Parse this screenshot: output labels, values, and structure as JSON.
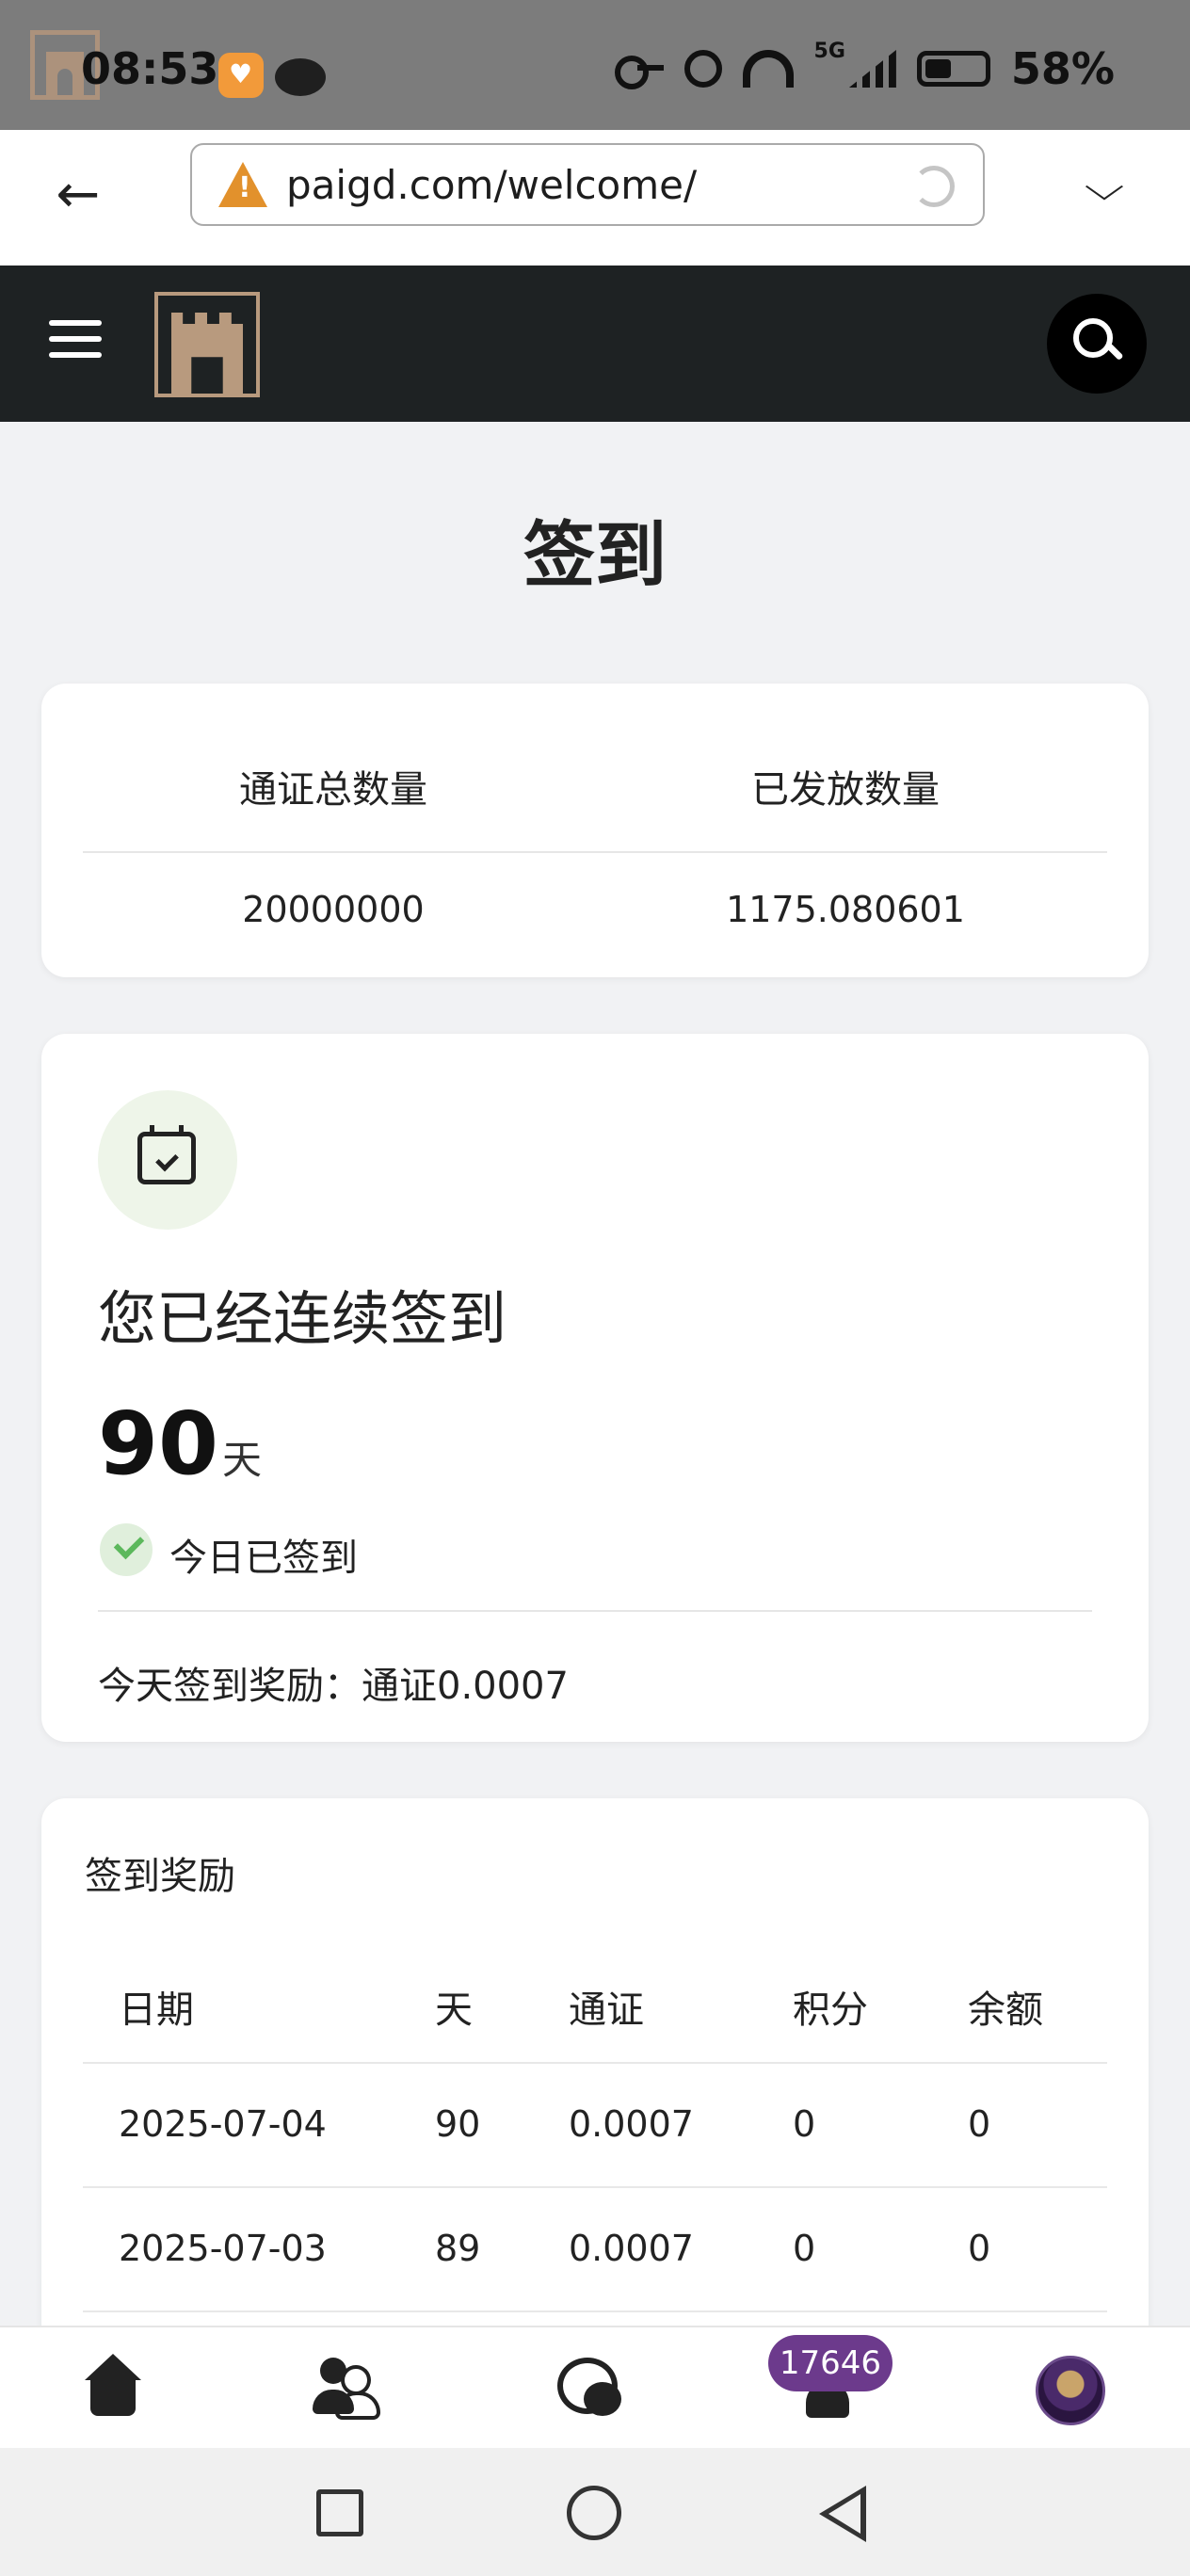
{
  "status_bar": {
    "time": "08:53",
    "network": "5G",
    "battery": "58%"
  },
  "browser": {
    "url": "paigd.com/welcome/"
  },
  "page": {
    "title": "签到"
  },
  "token_stats": {
    "total_label": "通证总数量",
    "issued_label": "已发放数量",
    "total_value": "20000000",
    "issued_value": "1175.080601"
  },
  "checkin": {
    "title": "您已经连续签到",
    "streak_days": "90",
    "streak_unit": "天",
    "status": "今日已签到",
    "reward": "今天签到奖励：通证0.0007"
  },
  "rewards_table": {
    "title": "签到奖励",
    "headers": [
      "日期",
      "天",
      "通证",
      "积分",
      "余额"
    ],
    "rows": [
      [
        "2025-07-04",
        "90",
        "0.0007",
        "0",
        "0"
      ],
      [
        "2025-07-03",
        "89",
        "0.0007",
        "0",
        "0"
      ]
    ]
  },
  "bottom_nav": {
    "notification_count": "17646"
  },
  "colors": {
    "header_bg": "#1e2223",
    "logo_gold": "#b89a7e",
    "badge_purple": "#6c3a8c",
    "success_green": "#5cb85c",
    "page_bg": "#f1f2f4"
  }
}
